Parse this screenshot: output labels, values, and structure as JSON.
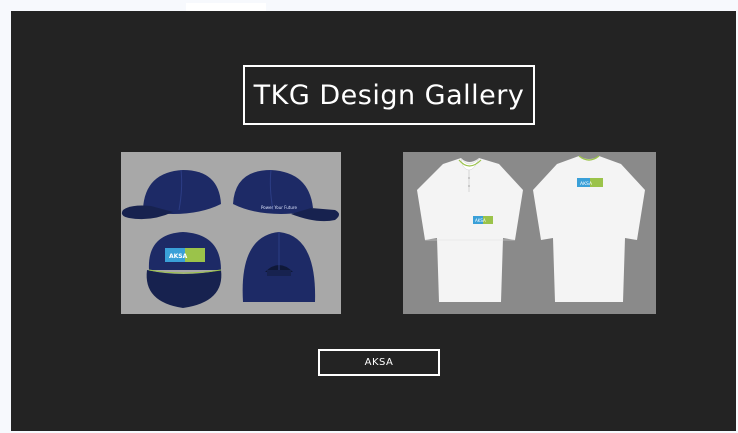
{
  "gallery": {
    "title": "TKG Design Gallery",
    "button_label": "AKSA"
  },
  "caps_panel": {
    "cap_back_text": "Power Your Future",
    "cap_patch_text": "AKSA"
  },
  "polos_panel": {
    "front_badge_text": "AKSA",
    "back_badge_text": "AKSA"
  },
  "colors": {
    "background": "#232323",
    "cap_navy": "#1d2a66",
    "accent_green": "#9bc34a",
    "accent_blue": "#3aa0d8"
  }
}
